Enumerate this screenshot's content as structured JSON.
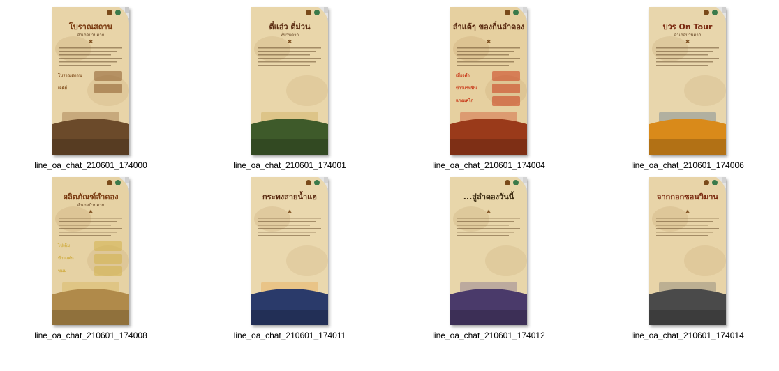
{
  "explorer": {
    "files": [
      {
        "filename": "line_oa_chat_210601_174000",
        "poster": {
          "heading": "โบราณสถาน",
          "subheading": "อำเภอบ้านตาก",
          "labels": [
            "โบราณสถาน",
            "เจดีย์"
          ],
          "bg": "#e8d4a8",
          "title_color": "#7a3a10",
          "accent": "#8a5a2a",
          "bottom_color": "#6b4a2a",
          "side_color": "#c9c9c9"
        }
      },
      {
        "filename": "line_oa_chat_210601_174001",
        "poster": {
          "heading": "ตี๋แอ๋ว ตี๋ม่วน",
          "subheading": "ที่บ้านตาก",
          "labels": [],
          "bg": "#e9d6aa",
          "title_color": "#5a2a10",
          "accent": "#c9a24a",
          "bottom_color": "#3e5a2a",
          "side_color": "#cfcfcf"
        }
      },
      {
        "filename": "line_oa_chat_210601_174004",
        "poster": {
          "heading": "ลำแต้ๆ ของกิ๋นลำดอง",
          "subheading": "",
          "labels": [
            "เมี่ยงคำ",
            "ข้าวแรมฟืน",
            "แกงแคไก่"
          ],
          "bg": "#e6d0a0",
          "title_color": "#5a2a10",
          "accent": "#c93a1a",
          "bottom_color": "#9a3a1a",
          "side_color": "#d6d6d6"
        }
      },
      {
        "filename": "line_oa_chat_210601_174006",
        "poster": {
          "heading": "บวร On Tour",
          "subheading": "อำเภอบ้านตาก",
          "labels": [],
          "bg": "#e8d6ac",
          "title_color": "#7a2a10",
          "accent": "#4a6a8a",
          "bottom_color": "#d98a1a",
          "side_color": "#cfcfcf"
        }
      },
      {
        "filename": "line_oa_chat_210601_174008",
        "poster": {
          "heading": "ผลิตภัณฑ์ลำดอง",
          "subheading": "อำเภอบ้านตาก",
          "labels": [
            "ไข่เค็ม",
            "ข้าวแต๋น",
            "ขนม"
          ],
          "bg": "#e6d2a4",
          "title_color": "#7a3a10",
          "accent": "#d2b04a",
          "bottom_color": "#b08a4a",
          "side_color": "#d0d0d0"
        }
      },
      {
        "filename": "line_oa_chat_210601_174011",
        "poster": {
          "heading": "กระทงสายน้ำแฮ",
          "subheading": "",
          "labels": [],
          "bg": "#ead8ae",
          "title_color": "#5a2a10",
          "accent": "#e8a040",
          "bottom_color": "#2a3a6a",
          "side_color": "#d2d2d2"
        }
      },
      {
        "filename": "line_oa_chat_210601_174012",
        "poster": {
          "heading": "...สู่ลำดองวันนี้",
          "subheading": "",
          "labels": [],
          "bg": "#e8d6aa",
          "title_color": "#3a2a10",
          "accent": "#6a5a8a",
          "bottom_color": "#4a3a6a",
          "side_color": "#d4d4d4"
        }
      },
      {
        "filename": "line_oa_chat_210601_174014",
        "poster": {
          "heading": "จากกอกซอนวิมาน",
          "subheading": "",
          "labels": [],
          "bg": "#e8d4a8",
          "title_color": "#7a2a10",
          "accent": "#6a6a6a",
          "bottom_color": "#4a4a4a",
          "side_color": "#d2d2d2"
        }
      }
    ]
  }
}
